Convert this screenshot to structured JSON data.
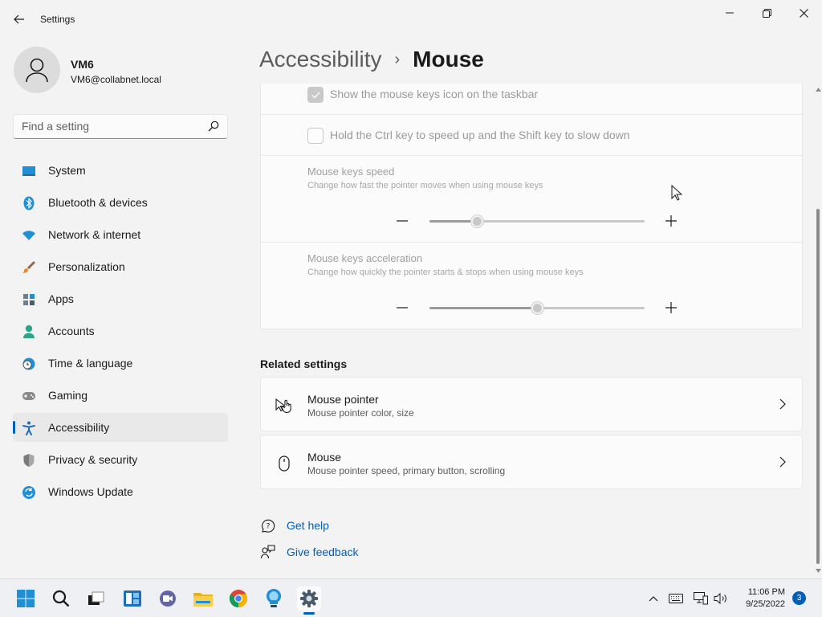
{
  "window": {
    "app_title": "Settings"
  },
  "user": {
    "name": "VM6",
    "email": "VM6@collabnet.local"
  },
  "search": {
    "placeholder": "Find a setting",
    "value": ""
  },
  "sidebar": {
    "items": [
      {
        "label": "System",
        "icon": "system-icon",
        "active": false
      },
      {
        "label": "Bluetooth & devices",
        "icon": "bluetooth-icon",
        "active": false
      },
      {
        "label": "Network & internet",
        "icon": "wifi-icon",
        "active": false
      },
      {
        "label": "Personalization",
        "icon": "brush-icon",
        "active": false
      },
      {
        "label": "Apps",
        "icon": "apps-icon",
        "active": false
      },
      {
        "label": "Accounts",
        "icon": "person-icon",
        "active": false
      },
      {
        "label": "Time & language",
        "icon": "clock-globe-icon",
        "active": false
      },
      {
        "label": "Gaming",
        "icon": "gamepad-icon",
        "active": false
      },
      {
        "label": "Accessibility",
        "icon": "accessibility-icon",
        "active": true
      },
      {
        "label": "Privacy & security",
        "icon": "shield-icon",
        "active": false
      },
      {
        "label": "Windows Update",
        "icon": "update-icon",
        "active": false
      }
    ]
  },
  "header": {
    "parent": "Accessibility",
    "separator": "›",
    "current": "Mouse"
  },
  "mouse_keys": {
    "show_icon_checkbox": {
      "label": "Show the mouse keys icon on the taskbar",
      "checked": true,
      "enabled": false
    },
    "ctrl_shift_checkbox": {
      "label": "Hold the Ctrl key to speed up and the Shift key to slow down",
      "checked": false,
      "enabled": false
    },
    "speed": {
      "title": "Mouse keys speed",
      "description": "Change how fast the pointer moves when using mouse keys",
      "value_fraction": 0.22
    },
    "acceleration": {
      "title": "Mouse keys acceleration",
      "description": "Change how quickly the pointer starts & stops when using mouse keys",
      "value_fraction": 0.5
    }
  },
  "related": {
    "title": "Related settings",
    "items": [
      {
        "title": "Mouse pointer",
        "description": "Mouse pointer color, size",
        "icon": "mouse-pointer-icon"
      },
      {
        "title": "Mouse",
        "description": "Mouse pointer speed, primary button, scrolling",
        "icon": "mouse-icon"
      }
    ]
  },
  "help": {
    "get_help": "Get help",
    "give_feedback": "Give feedback"
  },
  "taskbar": {
    "time": "11:06 PM",
    "date": "9/25/2022",
    "notification_count": "3"
  },
  "colors": {
    "accent": "#005fb8",
    "background": "#f3f3f3",
    "card": "#fbfbfb"
  }
}
